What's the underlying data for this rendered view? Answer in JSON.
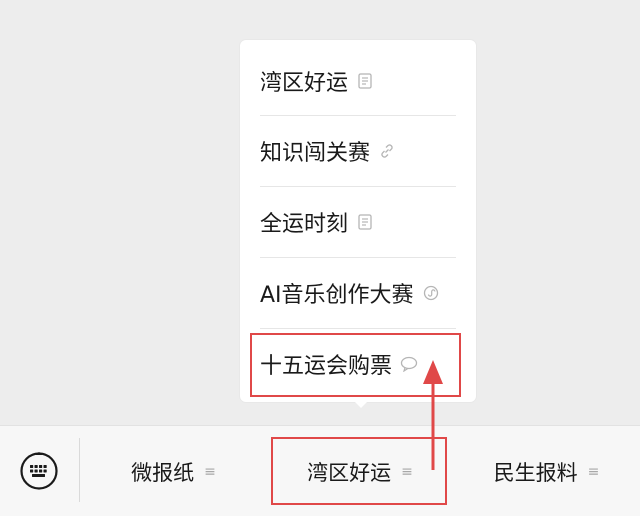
{
  "popup": {
    "items": [
      {
        "label": "湾区好运",
        "icon": "article-icon"
      },
      {
        "label": "知识闯关赛",
        "icon": "link-icon"
      },
      {
        "label": "全运时刻",
        "icon": "article-icon"
      },
      {
        "label": "AI音乐创作大赛",
        "icon": "mini-program-icon"
      },
      {
        "label": "十五运会购票",
        "icon": "chat-bubble-icon"
      }
    ]
  },
  "bottom_bar": {
    "keyboard_icon": "keyboard-icon",
    "tabs": [
      {
        "label": "微报纸",
        "icon": "menu-lines-icon"
      },
      {
        "label": "湾区好运",
        "icon": "menu-lines-icon"
      },
      {
        "label": "民生报料",
        "icon": "menu-lines-icon"
      }
    ]
  },
  "annotation_color": "#e04848"
}
